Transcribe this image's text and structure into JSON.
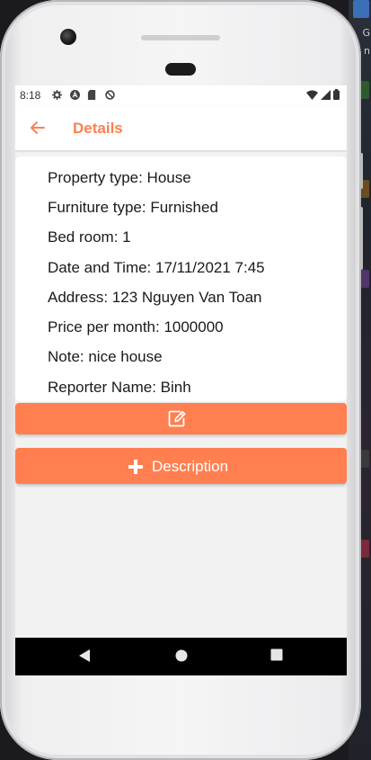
{
  "status_bar": {
    "time": "8:18",
    "left_icons": [
      "gear-icon",
      "a-circle-icon",
      "sd-card-icon",
      "no-entry-icon"
    ],
    "right_icons": [
      "wifi-icon",
      "signal-icon",
      "battery-icon"
    ]
  },
  "app_bar": {
    "back_icon": "arrow-left-icon",
    "title": "Details",
    "accent_color": "#ff7f50"
  },
  "details": [
    {
      "text": "Property type: House"
    },
    {
      "text": "Furniture type: Furnished"
    },
    {
      "text": "Bed room: 1"
    },
    {
      "text": "Date and Time: 17/11/2021 7:45"
    },
    {
      "text": "Address: 123 Nguyen Van Toan"
    },
    {
      "text": "Price per month: 1000000"
    },
    {
      "text": "Note: nice house"
    },
    {
      "text": "Reporter Name: Binh"
    }
  ],
  "actions": {
    "edit_icon": "edit-icon",
    "description_icon": "plus-icon",
    "description_label": "Description",
    "button_color": "#ff7f50"
  },
  "nav_bar": {
    "items": [
      "back-triangle-icon",
      "home-circle-icon",
      "recents-square-icon"
    ]
  },
  "background_text": {
    "line1": "G",
    "line2": "n"
  }
}
